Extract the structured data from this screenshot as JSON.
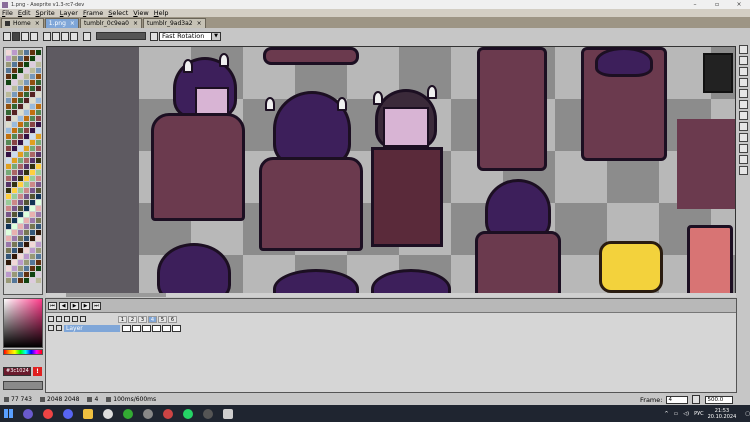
{
  "window": {
    "title": "1.png - Aseprite v1.3-rc7-dev"
  },
  "menu": [
    "File",
    "Edit",
    "Sprite",
    "Layer",
    "Frame",
    "Select",
    "View",
    "Help"
  ],
  "tabs": [
    {
      "label": "Home"
    },
    {
      "label": "1.png"
    },
    {
      "label": "tumblr_0c9ea0"
    },
    {
      "label": "tumblr_9ad3a2"
    }
  ],
  "toolbar": {
    "rotation_algorithm": "Fast Rotation"
  },
  "colorbar": {
    "fg_color_hex": "#3c1024",
    "warning": "!"
  },
  "timeline": {
    "layer_name": "Layer",
    "frames": [
      "1",
      "2",
      "3",
      "4",
      "5",
      "6"
    ],
    "active_frame": "4"
  },
  "statusbar": {
    "cursor": "77 743",
    "size": "2048 2048",
    "frame_info": "4",
    "duration": "100ms/600ms",
    "frame_label": "Frame:",
    "frame_value": "4",
    "zoom": "500.0"
  },
  "taskbar": {
    "time": "21:53",
    "date": "20.10.2024",
    "lang": "РУС"
  },
  "colors": {
    "accent": "#7fa6d8",
    "canvas_bg": "#5e5a61"
  }
}
